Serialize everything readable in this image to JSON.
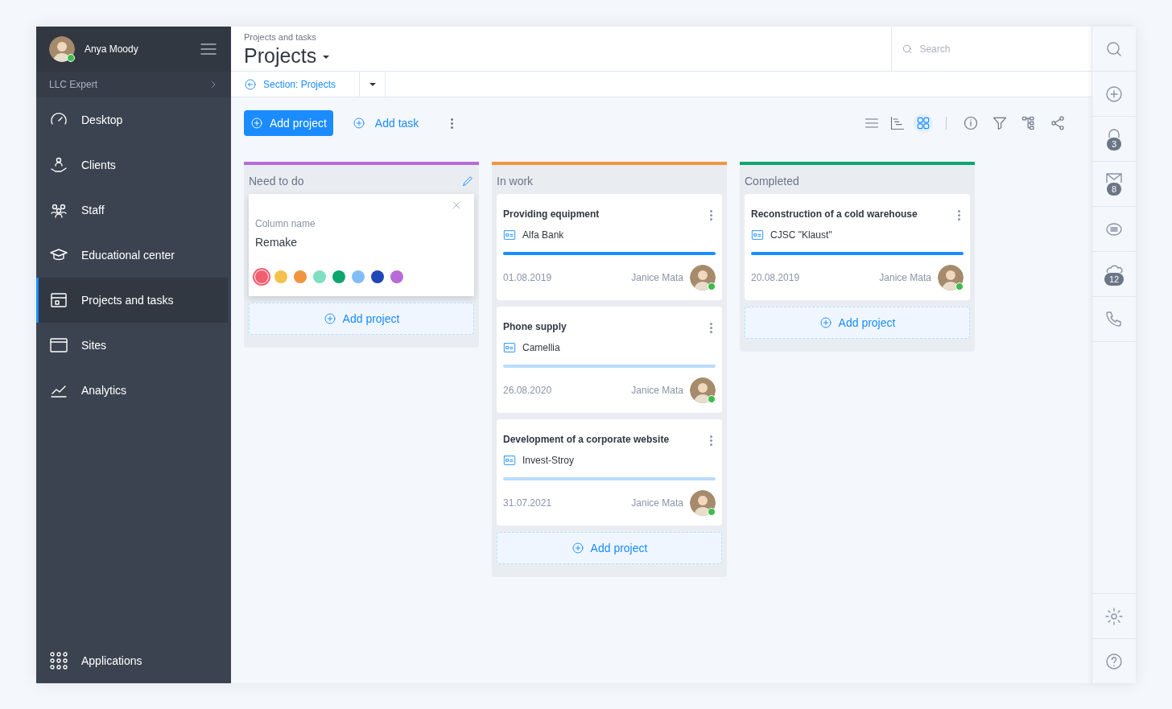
{
  "user": {
    "name": "Anya Moody",
    "online": true
  },
  "company": "LLC Expert",
  "nav": [
    {
      "label": "Desktop",
      "selected": false
    },
    {
      "label": "Clients",
      "selected": false
    },
    {
      "label": "Staff",
      "selected": false
    },
    {
      "label": "Educational center",
      "selected": false
    },
    {
      "label": "Projects and tasks",
      "selected": true
    },
    {
      "label": "Sites",
      "selected": false
    },
    {
      "label": "Analytics",
      "selected": false
    }
  ],
  "apps_label": "Applications",
  "header": {
    "breadcrumb": "Projects and tasks",
    "title": "Projects",
    "section": "Section: Projects",
    "search_placeholder": "Search"
  },
  "toolbar": {
    "add_project": "Add project",
    "add_task": "Add task",
    "views": [
      {
        "selected": false
      },
      {
        "selected": false
      },
      {
        "selected": true
      }
    ]
  },
  "columns": [
    {
      "title": "Need to do",
      "color": "#b86bd8",
      "editing": true,
      "edit": {
        "label": "Column name",
        "value": "Remake",
        "colors": [
          {
            "color": "#f25f6f",
            "selected": true
          },
          {
            "color": "#f2c14e",
            "selected": false
          },
          {
            "color": "#f0953f",
            "selected": false
          },
          {
            "color": "#7fdfc2",
            "selected": false
          },
          {
            "color": "#0ea66e",
            "selected": false
          },
          {
            "color": "#82bdf7",
            "selected": false
          },
          {
            "color": "#1f47b5",
            "selected": false
          },
          {
            "color": "#b86bd8",
            "selected": false
          }
        ]
      },
      "add": "Add project"
    },
    {
      "title": "In work",
      "color": "#f0953f",
      "editing": false,
      "cards": [
        {
          "title": "Providing equipment",
          "client": "Alfa Bank",
          "bar_active": true,
          "date": "01.08.2019",
          "person": "Janice Mata"
        },
        {
          "title": "Phone supply",
          "client": "Camellia",
          "bar_active": false,
          "date": "26.08.2020",
          "person": "Janice Mata"
        },
        {
          "title": "Development of a corporate website",
          "client": "Invest-Stroy",
          "bar_active": false,
          "date": "31.07.2021",
          "person": "Janice Mata"
        }
      ],
      "add": "Add project"
    },
    {
      "title": "Completed",
      "color": "#0ea66e",
      "editing": false,
      "cards": [
        {
          "title": "Reconstruction of a cold warehouse",
          "client": "CJSC \"Klaust\"",
          "bar_active": true,
          "date": "20.08.2019",
          "person": "Janice Mata"
        }
      ],
      "add": "Add project"
    }
  ],
  "rail_badges": [
    {
      "badge": "3"
    },
    {
      "badge": "8"
    },
    {
      "badge": "12"
    }
  ]
}
